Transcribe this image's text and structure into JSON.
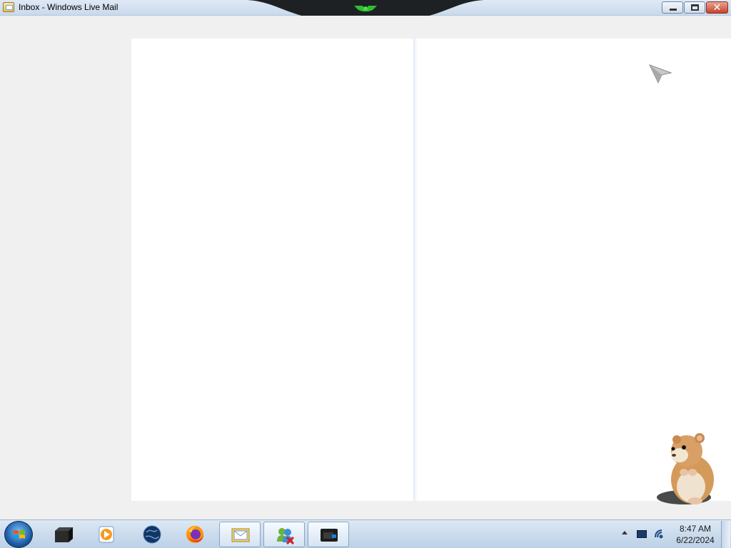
{
  "window": {
    "title": "Inbox - Windows Live Mail",
    "icon": "windows-live-mail-icon",
    "controls": {
      "minimize": "minimize-icon",
      "maximize": "restore-icon",
      "close_glyph": "✕"
    }
  },
  "panes": {
    "folder_pane": "",
    "message_list": "",
    "reading_pane": ""
  },
  "taskbar": {
    "start_icon": "windows-start-icon",
    "items": [
      {
        "name": "command-prompt-icon",
        "active": false
      },
      {
        "name": "media-player-icon",
        "active": false
      },
      {
        "name": "globe-browser-icon",
        "active": false
      },
      {
        "name": "firefox-icon",
        "active": false
      },
      {
        "name": "windows-live-mail-icon",
        "active": true
      },
      {
        "name": "messenger-icon",
        "active": true
      },
      {
        "name": "remote-desktop-icon",
        "active": true
      }
    ],
    "tray": {
      "time": "8:47 AM",
      "date": "6/22/2024"
    }
  },
  "colors": {
    "titlebar": "#c9d9ec",
    "taskbar": "#bcd0e6",
    "close_button": "#c7432c",
    "ornament_accent": "#3cc23c"
  }
}
